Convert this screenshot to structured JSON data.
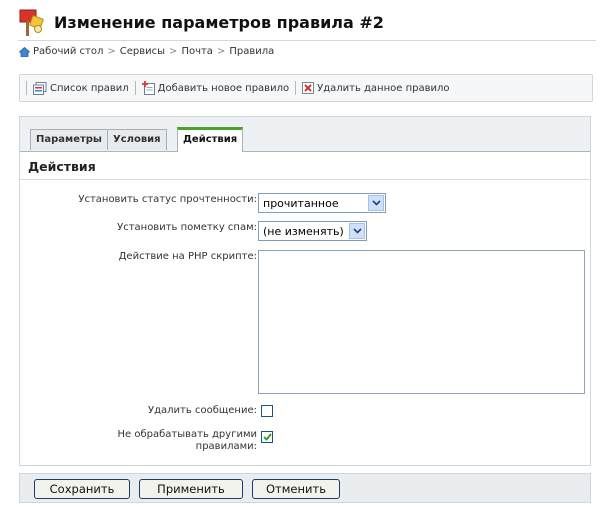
{
  "page": {
    "title": "Изменение параметров правила #2"
  },
  "breadcrumb": {
    "items": [
      "Рабочий стол",
      "Сервисы",
      "Почта",
      "Правила"
    ],
    "separator": ">"
  },
  "toolbar": {
    "list_label": "Список правил",
    "add_label": "Добавить новое правило",
    "delete_label": "Удалить данное правило"
  },
  "tabs": {
    "params": "Параметры",
    "conditions": "Условия",
    "actions": "Действия",
    "active": "Действия"
  },
  "section": {
    "title": "Действия"
  },
  "form": {
    "read_status_label": "Установить статус прочтенности:",
    "read_status_value": "прочитанное",
    "spam_label": "Установить пометку спам:",
    "spam_value": "(не изменять)",
    "php_label": "Действие на PHP скрипте:",
    "php_value": "",
    "delete_label": "Удалить сообщение:",
    "delete_checked": false,
    "no_other_rules_label_line1": "Не обрабатывать другими",
    "no_other_rules_label_line2": "правилами:",
    "no_other_rules_checked": true
  },
  "buttons": {
    "save": "Сохранить",
    "apply": "Применить",
    "cancel": "Отменить"
  },
  "colors": {
    "active_tab_accent": "#4f9f2c",
    "button_border": "#1e3c6a",
    "select_border": "#7f9db9"
  },
  "icons": {
    "title": "rules-settings-icon",
    "breadcrumb_home": "home-icon",
    "list": "list-icon",
    "add": "add-document-icon",
    "delete": "delete-icon"
  }
}
